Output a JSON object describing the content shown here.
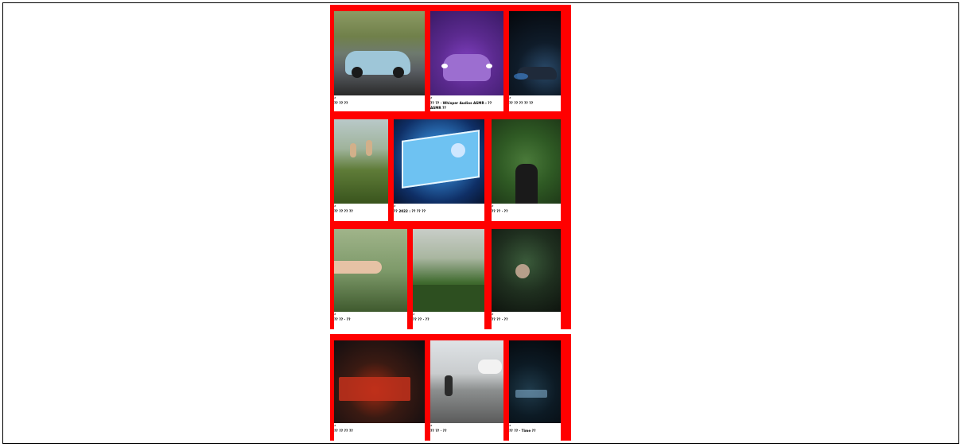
{
  "cards": [
    {
      "category": "#",
      "title": "?? ?? ??"
    },
    {
      "category": "#",
      "title": "?? ?? · Whisper Audios ASMR : ?? ASMR ??"
    },
    {
      "category": "#",
      "title": "?? ?? ?? ?? ??"
    },
    {
      "category": "#",
      "title": "?? ?? ?? ??"
    },
    {
      "category": "#",
      "title": "?? 2022 : ?? ?? ??"
    },
    {
      "category": "#",
      "title": "?? ?? · ??"
    },
    {
      "category": "#",
      "title": "?? ?? · ??"
    },
    {
      "category": "#",
      "title": "?? ?? · ??"
    },
    {
      "category": "#",
      "title": "?? ?? · ??"
    },
    {
      "category": "#",
      "title": "?? ?? ?? ??"
    },
    {
      "category": "#",
      "title": "?? ?? · ??"
    },
    {
      "category": "#",
      "title": "?? ?? · Time ??"
    }
  ]
}
